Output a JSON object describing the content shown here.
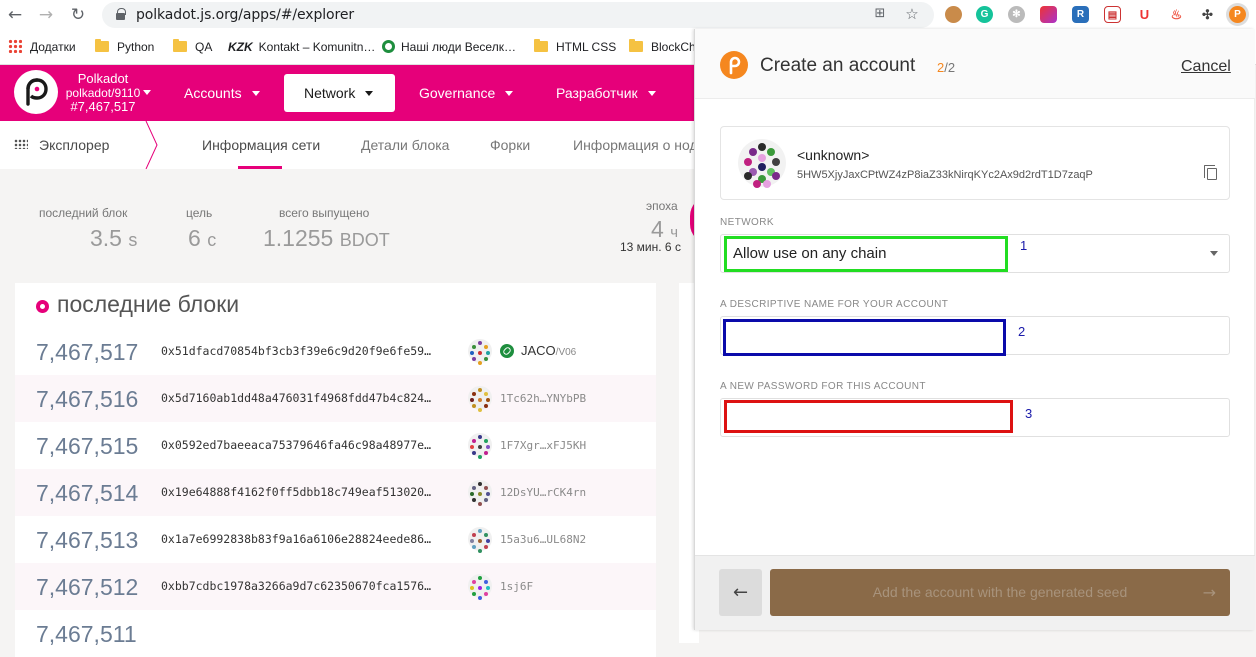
{
  "browser": {
    "url": "polkadot.js.org/apps/#/explorer"
  },
  "bookmarks": [
    {
      "label": "Додатки",
      "icon": "apps-grid-icon"
    },
    {
      "label": "Python",
      "icon": "folder-icon"
    },
    {
      "label": "QA",
      "icon": "folder-icon"
    },
    {
      "label": "Kontakt – Komunitn…",
      "icon": "kzk-logo-icon",
      "logo_text": "KZK"
    },
    {
      "label": "Наші люди Веселк…",
      "icon": "green-ring-icon"
    },
    {
      "label": "HTML CSS",
      "icon": "folder-icon"
    },
    {
      "label": "BlockCh",
      "icon": "folder-icon"
    }
  ],
  "chain": {
    "name": "Polkadot",
    "runtime": "polkadot/9110",
    "block": "#7,467,517"
  },
  "menu": {
    "accounts": "Accounts",
    "network": "Network",
    "governance": "Governance",
    "developer": "Разработчик"
  },
  "subnav": {
    "explorer": "Эксплорер",
    "tabs": [
      "Информация сети",
      "Детали блока",
      "Форки",
      "Информация о нод"
    ]
  },
  "stats": {
    "last_block_label": "последний блок",
    "last_block_value": "3.5",
    "last_block_unit": "s",
    "target_label": "цель",
    "target_value": "6",
    "target_unit": "с",
    "issuance_label": "всего выпущено",
    "issuance_value": "1.1255",
    "issuance_unit": "BDOT",
    "epoch_label": "эпоха",
    "epoch_value": "4",
    "epoch_unit": "ч",
    "epoch_sub": "13 мин. 6 с"
  },
  "blocks": {
    "title": "последние блоки",
    "rows": [
      {
        "number": "7,467,517",
        "hash": "0x51dfacd70854bf3cb3f39e6c9d20f9e6fe59…",
        "author": "JACO",
        "author_sub": "/V06",
        "named": true
      },
      {
        "number": "7,467,516",
        "hash": "0x5d7160ab1dd48a476031f4968fdd47b4c824…",
        "author": "1Tc62h…YNYbPB",
        "named": false
      },
      {
        "number": "7,467,515",
        "hash": "0x0592ed7baeeaca75379646fa46c98a48977e…",
        "author": "1F7Xgr…xFJ5KH",
        "named": false
      },
      {
        "number": "7,467,514",
        "hash": "0x19e64888f4162f0ff5dbb18c749eaf513020…",
        "author": "12DsYU…rCK4rn",
        "named": false
      },
      {
        "number": "7,467,513",
        "hash": "0x1a7e6992838b83f9a16a6106e28824eede86…",
        "author": "15a3u6…UL68N2",
        "named": false
      },
      {
        "number": "7,467,512",
        "hash": "0xbb7cdbc1978a3266a9d7c62350670fca1576…",
        "author": "1sj6F",
        "named": false
      },
      {
        "number": "7,467,511",
        "hash": "",
        "author": "",
        "named": false
      }
    ]
  },
  "popup": {
    "title": "Create an account",
    "step_current": "2",
    "step_total": "/2",
    "cancel": "Cancel",
    "account_name": "<unknown>",
    "account_address": "5HW5XjyJaxCPtWZ4zP8iaZ33kNirqKYc2Ax9d2rdT1D7zaqP",
    "network_label": "NETWORK",
    "network_value": "Allow use on any chain",
    "name_label": "A DESCRIPTIVE NAME FOR YOUR ACCOUNT",
    "name_value": "",
    "password_label": "A NEW PASSWORD FOR THIS ACCOUNT",
    "password_value": "",
    "annotation_1": "1",
    "annotation_2": "2",
    "annotation_3": "3",
    "add_button": "Add the account with the generated seed",
    "back_arrow": "←",
    "forward_arrow": "→"
  },
  "colors": {
    "brand": "#e6007a",
    "extension_orange": "#f5871f",
    "add_button_bg": "#8a6a48",
    "highlight_1": "#22dd22",
    "highlight_2": "#0a0aaa",
    "highlight_3": "#dd1111"
  }
}
